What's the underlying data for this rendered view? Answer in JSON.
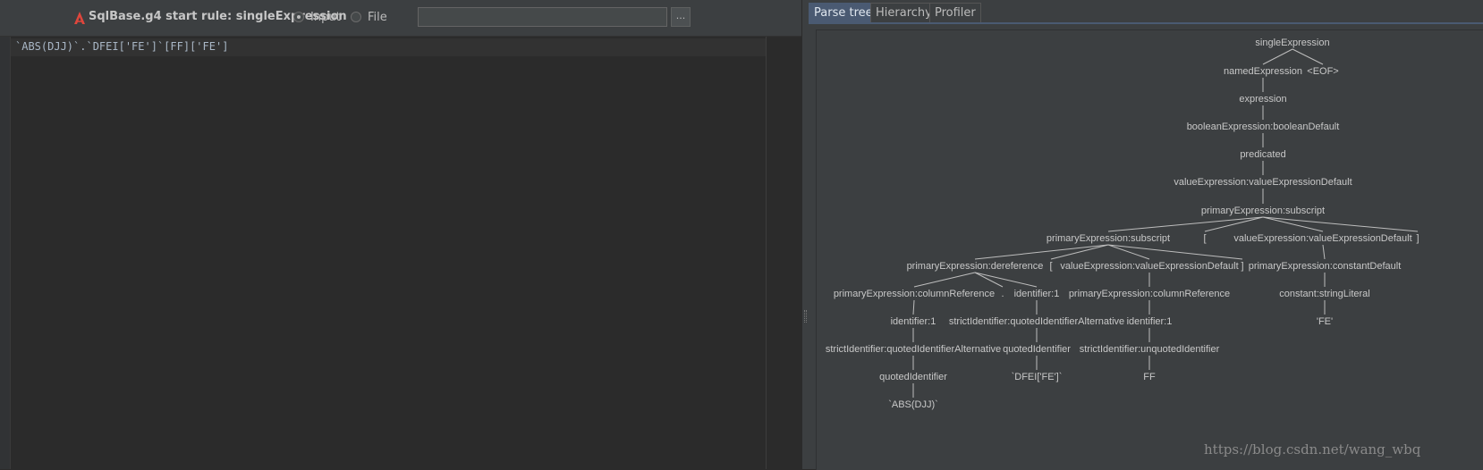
{
  "toolbar": {
    "rule_title": "SqlBase.g4 start rule: singleExpression",
    "input_label": "Input",
    "file_label": "File",
    "file_path": "",
    "browse_label": "..."
  },
  "editor": {
    "text": "`ABS(DJJ)`.`DFEI['FE']`[FF]['FE']"
  },
  "tabs": [
    "Parse tree",
    "Hierarchy",
    "Profiler"
  ],
  "active_tab": "Parse tree",
  "parse_tree": {
    "nodes": [
      {
        "id": "n1",
        "label": "singleExpression"
      },
      {
        "id": "n2",
        "label": "namedExpression"
      },
      {
        "id": "n3",
        "label": "<EOF>"
      },
      {
        "id": "n4",
        "label": "expression"
      },
      {
        "id": "n5",
        "label": "booleanExpression:booleanDefault"
      },
      {
        "id": "n6",
        "label": "predicated"
      },
      {
        "id": "n7",
        "label": "valueExpression:valueExpressionDefault"
      },
      {
        "id": "n8",
        "label": "primaryExpression:subscript"
      },
      {
        "id": "n9",
        "label": "primaryExpression:subscript"
      },
      {
        "id": "n10",
        "label": "["
      },
      {
        "id": "n11",
        "label": "valueExpression:valueExpressionDefault"
      },
      {
        "id": "n12",
        "label": "]"
      },
      {
        "id": "n13",
        "label": "primaryExpression:dereference"
      },
      {
        "id": "n14",
        "label": "["
      },
      {
        "id": "n15",
        "label": "valueExpression:valueExpressionDefault"
      },
      {
        "id": "n16",
        "label": "]"
      },
      {
        "id": "n17",
        "label": "primaryExpression:constantDefault"
      },
      {
        "id": "n18",
        "label": "primaryExpression:columnReference"
      },
      {
        "id": "n19",
        "label": "."
      },
      {
        "id": "n20",
        "label": "identifier:1"
      },
      {
        "id": "n21",
        "label": "primaryExpression:columnReference"
      },
      {
        "id": "n22",
        "label": "constant:stringLiteral"
      },
      {
        "id": "n23",
        "label": "identifier:1"
      },
      {
        "id": "n24",
        "label": "strictIdentifier:quotedIdentifierAlternative"
      },
      {
        "id": "n25",
        "label": "identifier:1"
      },
      {
        "id": "n26",
        "label": "'FE'"
      },
      {
        "id": "n27",
        "label": "strictIdentifier:quotedIdentifierAlternative"
      },
      {
        "id": "n28",
        "label": "quotedIdentifier"
      },
      {
        "id": "n29",
        "label": "strictIdentifier:unquotedIdentifier"
      },
      {
        "id": "n30",
        "label": "quotedIdentifier"
      },
      {
        "id": "n31",
        "label": "`DFEI['FE']`"
      },
      {
        "id": "n32",
        "label": "FF"
      },
      {
        "id": "n33",
        "label": "`ABS(DJJ)`"
      }
    ],
    "edges": [
      [
        "n1",
        "n2"
      ],
      [
        "n1",
        "n3"
      ],
      [
        "n2",
        "n4"
      ],
      [
        "n4",
        "n5"
      ],
      [
        "n5",
        "n6"
      ],
      [
        "n6",
        "n7"
      ],
      [
        "n7",
        "n8"
      ],
      [
        "n8",
        "n9"
      ],
      [
        "n8",
        "n10"
      ],
      [
        "n8",
        "n11"
      ],
      [
        "n8",
        "n12"
      ],
      [
        "n9",
        "n13"
      ],
      [
        "n9",
        "n14"
      ],
      [
        "n9",
        "n15"
      ],
      [
        "n9",
        "n16"
      ],
      [
        "n11",
        "n17"
      ],
      [
        "n13",
        "n18"
      ],
      [
        "n13",
        "n19"
      ],
      [
        "n13",
        "n20"
      ],
      [
        "n15",
        "n21"
      ],
      [
        "n17",
        "n22"
      ],
      [
        "n18",
        "n23"
      ],
      [
        "n20",
        "n24"
      ],
      [
        "n21",
        "n25"
      ],
      [
        "n22",
        "n26"
      ],
      [
        "n23",
        "n27"
      ],
      [
        "n24",
        "n28"
      ],
      [
        "n25",
        "n29"
      ],
      [
        "n27",
        "n30"
      ],
      [
        "n28",
        "n31"
      ],
      [
        "n29",
        "n32"
      ],
      [
        "n30",
        "n33"
      ]
    ]
  },
  "watermark": "https://blog.csdn.net/wang_wbq",
  "colors": {
    "background": "#2b2b2b",
    "panel": "#3c3f41",
    "active_tab": "#4a5a72",
    "antlr_icon": "#e0463c"
  },
  "icons": {
    "rule": "antlr-logo-icon"
  }
}
